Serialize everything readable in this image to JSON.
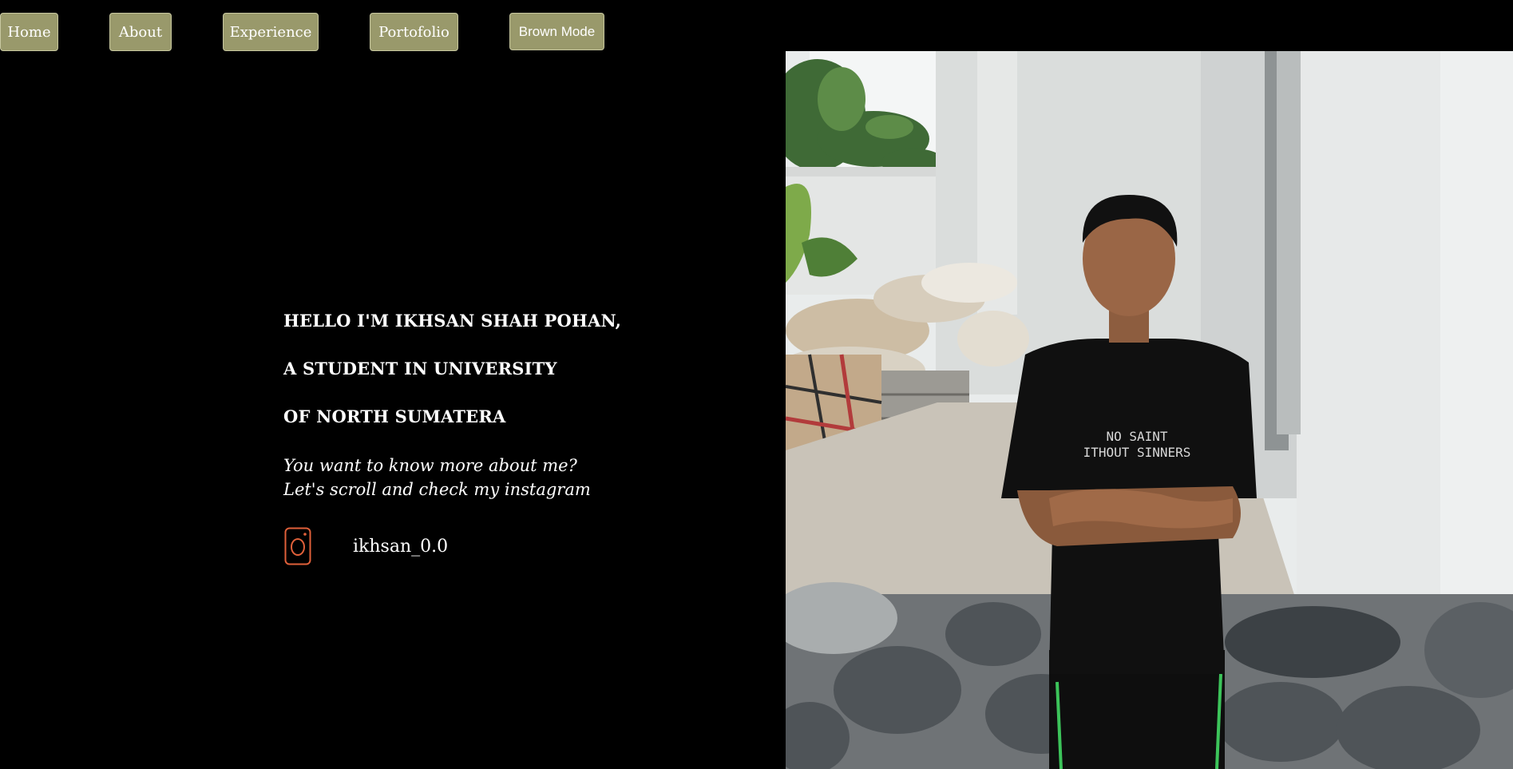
{
  "nav": {
    "home": "Home",
    "about": "About",
    "experience": "Experience",
    "portfolio": "Portofolio",
    "mode": "Brown Mode"
  },
  "hero": {
    "line1": "HELLO I'M IKHSAN SHAH POHAN,",
    "line2": "A STUDENT IN UNIVERSITY",
    "line3": "OF NORTH SUMATERA",
    "sub1": "You want to know more about me?",
    "sub2": "Let's scroll and check my instagram"
  },
  "social": {
    "icon": "instagram-icon",
    "handle": "ikhsan_0.0"
  },
  "photo": {
    "shirt_line1": "NO SAINT",
    "shirt_line2": "ITHOUT SINNERS"
  },
  "colors": {
    "background": "#000000",
    "button": "#99996b",
    "text": "#ffffff",
    "icon": "#e0603a"
  }
}
